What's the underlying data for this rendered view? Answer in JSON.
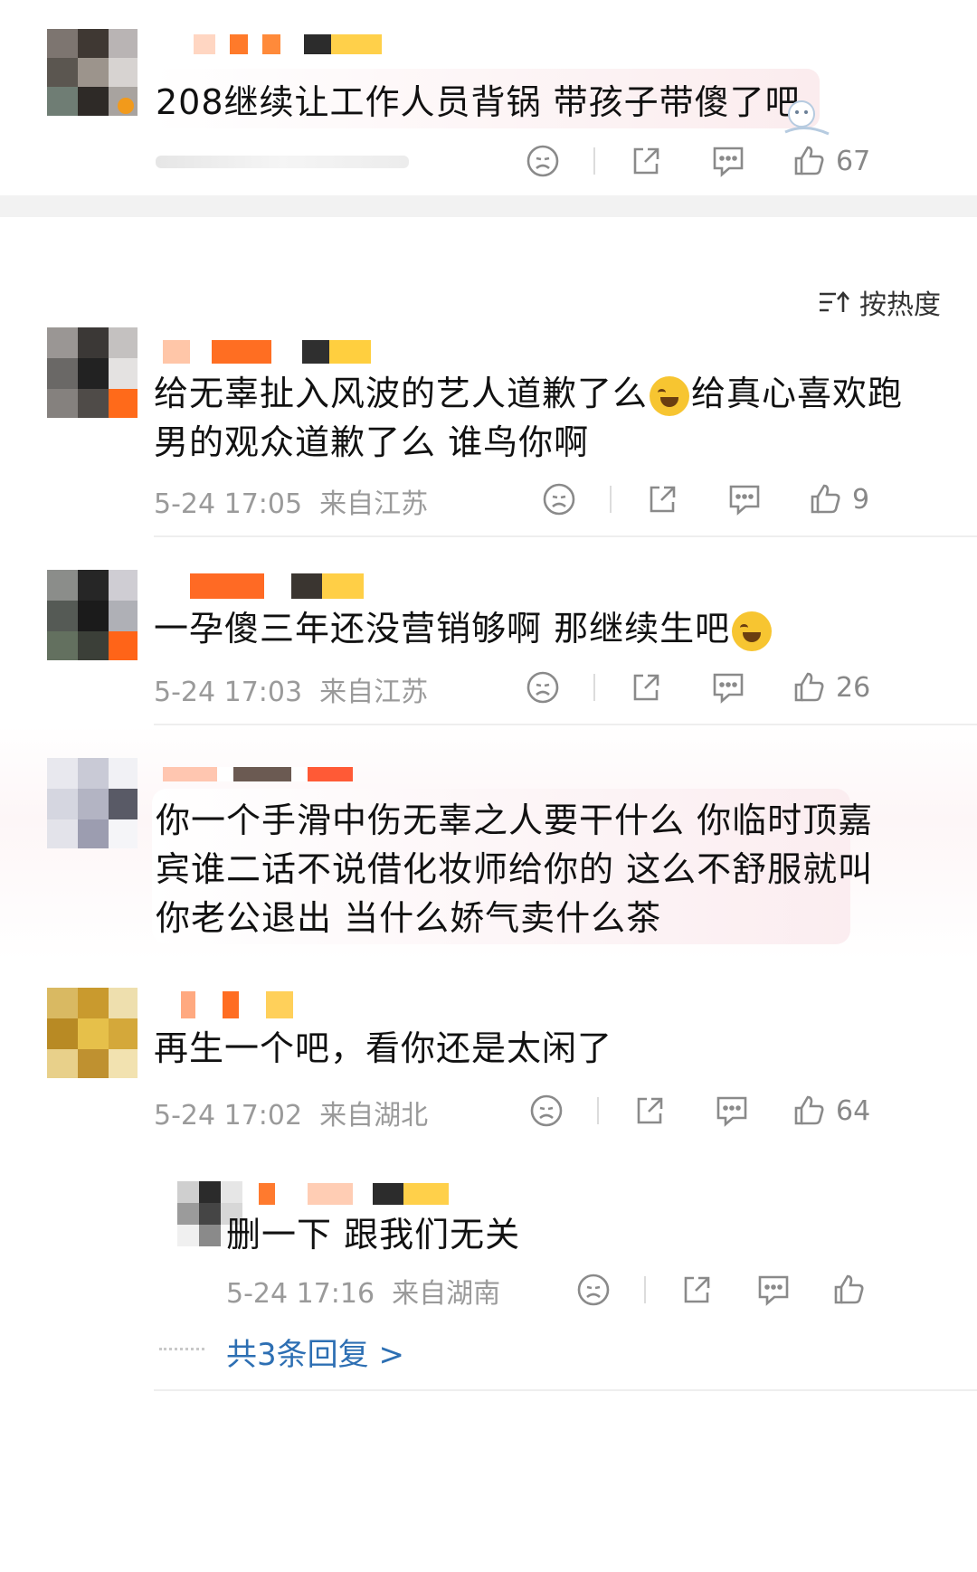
{
  "top_comment": {
    "text": "208继续让工作人员背锅 带孩子带傻了吧",
    "like_count": "67"
  },
  "sort": {
    "label": "按热度"
  },
  "comments": [
    {
      "text_line1": "给无辜扯入风波的艺人道歉了么",
      "text_line1b": "给真心喜欢跑",
      "text_line2": "男的观众道歉了么 谁鸟你啊",
      "time": "5-24 17:05",
      "location": "来自江苏",
      "like_count": "9"
    },
    {
      "text_line1": "一孕傻三年还没营销够啊 那继续生吧",
      "time": "5-24 17:03",
      "location": "来自江苏",
      "like_count": "26"
    },
    {
      "text_line1": "你一个手滑中伤无辜之人要干什么 你临时顶嘉",
      "text_line2": "宾谁二话不说借化妆师给你的 这么不舒服就叫",
      "text_line3": "你老公退出 当什么娇气卖什么茶"
    },
    {
      "text_line1": "再生一个吧，看你还是太闲了",
      "time": "5-24 17:02",
      "location": "来自湖北",
      "like_count": "64"
    }
  ],
  "reply": {
    "text": "删一下 跟我们无关",
    "time": "5-24 17:16",
    "location": "来自湖南",
    "more_label": "共3条回复 >"
  },
  "icons": [
    "dislike-icon",
    "share-icon",
    "comment-icon",
    "like-icon",
    "sort-icon"
  ],
  "colors": {
    "link_blue": "#2d6fb3",
    "meta_gray": "#9a9a9a",
    "highlight_pink": "#fbecee"
  }
}
